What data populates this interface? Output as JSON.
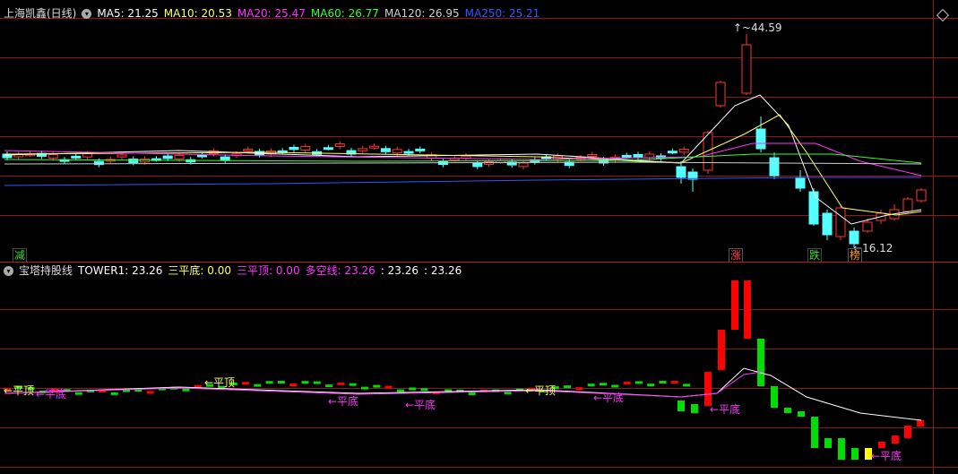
{
  "top": {
    "title": "上海凯鑫(日线)",
    "ma": [
      {
        "label": "MA5: 21.25",
        "color": "#ffffff"
      },
      {
        "label": "MA10: 20.53",
        "color": "#ffff66"
      },
      {
        "label": "MA20: 25.47",
        "color": "#ff33ff"
      },
      {
        "label": "MA60: 26.77",
        "color": "#33ff33"
      },
      {
        "label": "MA120: 26.95",
        "color": "#cccccc"
      },
      {
        "label": "MA250: 25.21",
        "color": "#3355ff"
      }
    ],
    "high_label": "44.59",
    "low_label": "16.12",
    "signals": [
      {
        "text": "减",
        "color": "#33dd33"
      },
      {
        "text": "涨",
        "color": "#ff4444"
      },
      {
        "text": "跌",
        "color": "#33dd33"
      },
      {
        "text": "榜",
        "color": "#ff9933"
      }
    ]
  },
  "bottom": {
    "title": "宝塔持股线",
    "legend": [
      {
        "label": "TOWER1: 23.26",
        "color": "#ffffff"
      },
      {
        "label": "三平底: 0.00",
        "color": "#ffff66"
      },
      {
        "label": "三平顶: 0.00",
        "color": "#ff33ff"
      },
      {
        "label": "多空线: 23.26",
        "color": "#ff33ff"
      },
      {
        "label": ": 23.26",
        "color": "#ffffff"
      },
      {
        "label": ": 23.26",
        "color": "#ffffff"
      }
    ],
    "annotations": [
      {
        "text": "←平顶",
        "color": "#ffff66"
      },
      {
        "text": "←平底",
        "color": "#ff33ff"
      },
      {
        "text": "←平顶",
        "color": "#ffff66"
      },
      {
        "text": "←平底",
        "color": "#ff33ff"
      },
      {
        "text": "←平底",
        "color": "#ff33ff"
      },
      {
        "text": "←平顶",
        "color": "#ffff66"
      },
      {
        "text": "←平底",
        "color": "#ff33ff"
      },
      {
        "text": "←平底",
        "color": "#ff33ff"
      },
      {
        "text": "←平底",
        "color": "#ff33ff"
      }
    ]
  },
  "colors": {
    "up": "#ff3333",
    "down": "#55ffff",
    "tower_up": "#ff0000",
    "tower_down": "#00dd00",
    "tower_neutral": "#ffff00"
  }
}
